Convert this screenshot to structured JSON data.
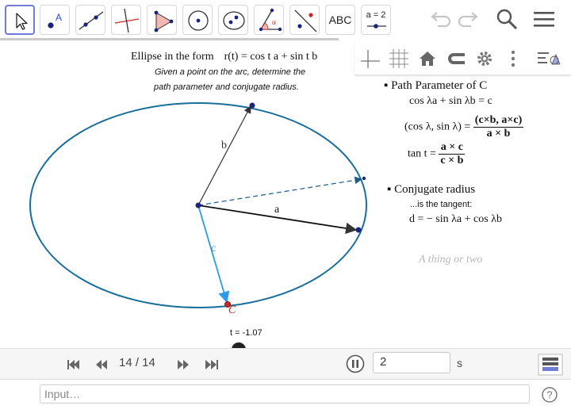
{
  "toolbar": {
    "tools": [
      "move-tool",
      "point-tool",
      "line-tool",
      "perpendicular-line-tool",
      "polygon-tool",
      "circle-tool",
      "ellipse-tool",
      "angle-tool",
      "reflect-tool",
      "text-tool",
      "slider-tool"
    ],
    "text_tool_label": "ABC",
    "slider_tool_label": "a = 2"
  },
  "canvas": {
    "title": "Ellipse in the form",
    "title_formula": "r(t) = cos t a + sin t b",
    "subtitle_line1": "Given a point on the arc, determine the",
    "subtitle_line2": "path parameter and conjugate radius.",
    "label_a": "a",
    "label_b": "b",
    "label_c": "c",
    "label_C": "C",
    "slider_label": "t = -1.07",
    "notes": {
      "heading1": "▪ Path Parameter of C",
      "eq1": "cos λa + sin λb = c",
      "eq2_left": "(cos λ, sin λ) =",
      "eq2_num": "(c×b, a×c)",
      "eq2_den": "a × b",
      "eq3_left": "tan t =",
      "eq3_num": "a × c",
      "eq3_den": "c × b",
      "heading2": "▪ Conjugate radius",
      "tangent_note": "...is the tangent:",
      "eq4": "d = − sin λa + cos λb",
      "aside": "A thing or two"
    }
  },
  "playback": {
    "counter": "14 / 14",
    "speed_value": "2",
    "speed_unit": "s"
  },
  "input_bar": {
    "placeholder": "Input…"
  },
  "colors": {
    "ellipse": "#1a6e9a",
    "vector_c": "#2c9be8",
    "dashed": "#1d5b8c",
    "point_blue": "#1a237e",
    "point_red": "#c62828",
    "toolbar_accent": "#6f7cd8"
  }
}
